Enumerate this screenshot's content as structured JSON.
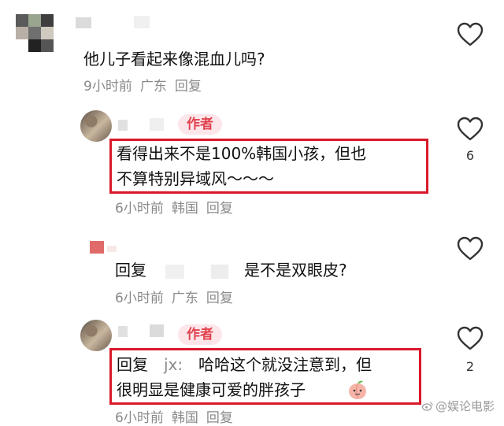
{
  "comments": [
    {
      "text": "他儿子看起来像混血儿吗?",
      "time": "9小时前",
      "location": "广东",
      "reply_label": "回复"
    },
    {
      "author_tag": "作者",
      "text_line1": "看得出来不是100%韩国小孩，但也",
      "text_line2": "不算特别异域风～～～",
      "time": "6小时前",
      "location": "韩国",
      "reply_label": "回复",
      "likes": "6"
    },
    {
      "reply_prefix": "回复",
      "text": "是不是双眼皮?",
      "time": "6小时前",
      "location": "广东",
      "reply_label": "回复"
    },
    {
      "author_tag": "作者",
      "reply_prefix": "回复",
      "reply_to": "jx:",
      "text_line1": "哈哈这个就没注意到，但",
      "text_line2": "很明显是健康可爱的胖孩子",
      "time": "6小时前",
      "location": "韩国",
      "reply_label": "回复",
      "likes": "2"
    }
  ],
  "watermark": "@娱论电影",
  "colors": {
    "highlight_box": "#d9192b",
    "author_tag_bg": "#fde6e9",
    "author_tag_text": "#e0424e",
    "meta_text": "#8a8a8a"
  },
  "icons": [
    "heart-outline-icon",
    "peach-emoji-icon",
    "weibo-logo-icon"
  ]
}
